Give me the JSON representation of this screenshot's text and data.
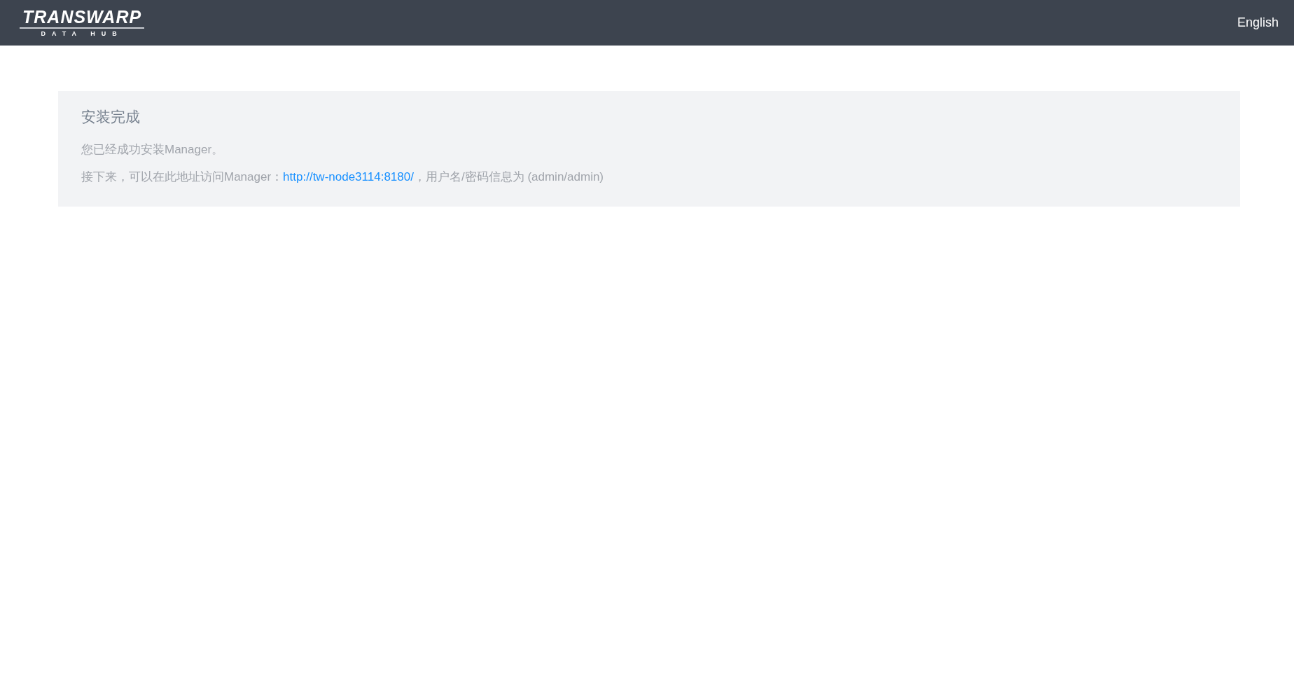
{
  "navbar": {
    "logo": {
      "title": "TRANSWARP",
      "subtitle": "DATA HUB"
    },
    "language": "English"
  },
  "panel": {
    "title": "安装完成",
    "message": "您已经成功安装Manager。",
    "access": {
      "before": "接下来，可以在此地址访问Manager：",
      "link": "http://tw-node3114:8180/",
      "after": "，用户名/密码信息为 (admin/admin)"
    }
  }
}
